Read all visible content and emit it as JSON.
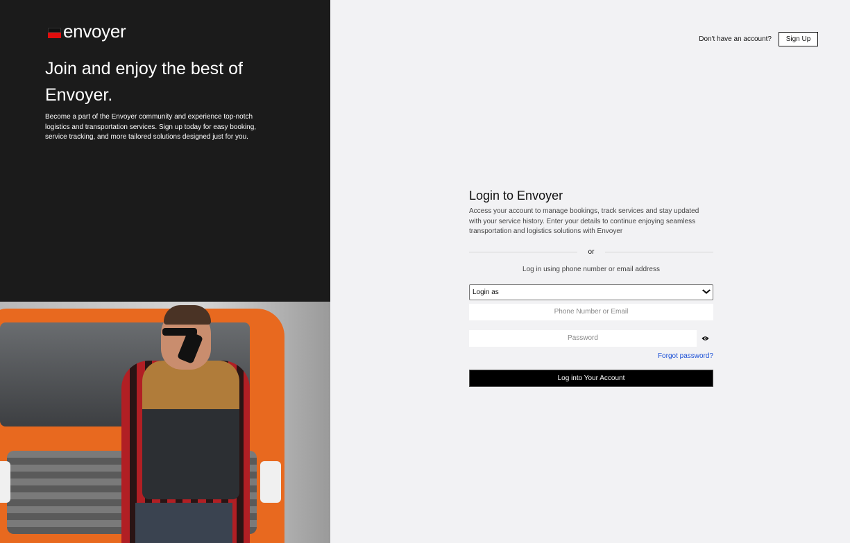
{
  "brand": {
    "name": "envoyer",
    "accent": "#e10d0d"
  },
  "hero": {
    "headline": "Join and enjoy the best of Envoyer.",
    "description": "Become a part of the Envoyer community and experience top-notch logistics and transportation services. Sign up today for easy booking, service tracking, and more tailored solutions designed just for you."
  },
  "topbar": {
    "question": "Don't have an account?",
    "signup_label": "Sign Up"
  },
  "login": {
    "title": "Login to Envoyer",
    "subtitle": "Access your account to manage bookings, track services and stay updated with your service history. Enter your details to continue enjoying seamless transportation and logistics solutions with Envoyer",
    "divider_text": "or",
    "hint": "Log in using phone number or email address",
    "role_select": {
      "selected": "Login as"
    },
    "identifier_placeholder": "Phone Number or Email",
    "password_placeholder": "Password",
    "forgot_label": "Forgot password?",
    "submit_label": "Log into Your Account"
  },
  "icons": {
    "password_toggle": "eye-icon",
    "select_toggle": "chevron-down-icon"
  }
}
